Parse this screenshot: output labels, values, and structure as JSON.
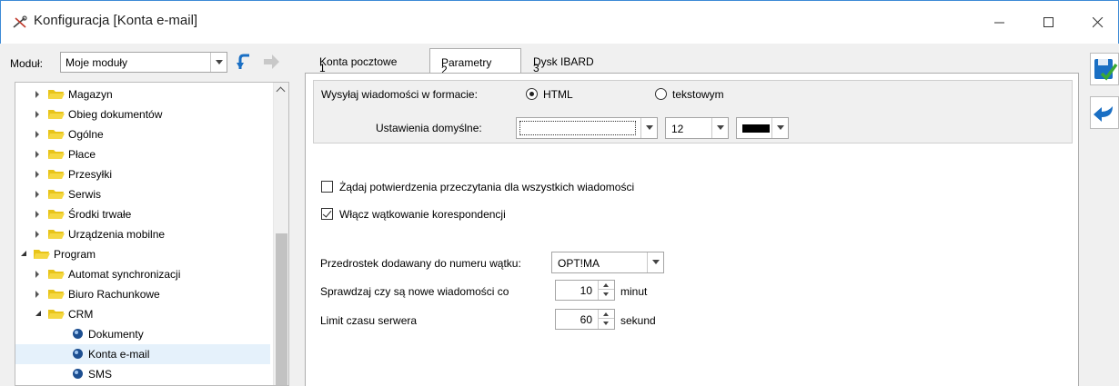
{
  "window": {
    "title": "Konfiguracja [Konta e-mail]"
  },
  "module": {
    "label": "Moduł:",
    "selected": "Moje moduły"
  },
  "tree": [
    {
      "label": "Magazyn",
      "level": 1,
      "expander": "closed",
      "icon": "folder-icon"
    },
    {
      "label": "Obieg dokumentów",
      "level": 1,
      "expander": "closed",
      "icon": "folder-icon"
    },
    {
      "label": "Ogólne",
      "level": 1,
      "expander": "closed",
      "icon": "folder-icon"
    },
    {
      "label": "Płace",
      "level": 1,
      "expander": "closed",
      "icon": "folder-icon"
    },
    {
      "label": "Przesyłki",
      "level": 1,
      "expander": "closed",
      "icon": "folder-icon"
    },
    {
      "label": "Serwis",
      "level": 1,
      "expander": "closed",
      "icon": "folder-icon"
    },
    {
      "label": "Środki trwałe",
      "level": 1,
      "expander": "closed",
      "icon": "folder-icon"
    },
    {
      "label": "Urządzenia mobilne",
      "level": 1,
      "expander": "closed",
      "icon": "folder-icon"
    },
    {
      "label": "Program",
      "level": 0,
      "expander": "open",
      "icon": "folder-icon"
    },
    {
      "label": "Automat synchronizacji",
      "level": 1,
      "expander": "closed",
      "icon": "folder-icon"
    },
    {
      "label": "Biuro Rachunkowe",
      "level": 1,
      "expander": "closed",
      "icon": "folder-icon"
    },
    {
      "label": "CRM",
      "level": 1,
      "expander": "open",
      "icon": "folder-icon"
    },
    {
      "label": "Dokumenty",
      "level": 2,
      "expander": "none",
      "icon": "settings-icon"
    },
    {
      "label": "Konta e-mail",
      "level": 2,
      "expander": "none",
      "icon": "settings-icon",
      "selected": true
    },
    {
      "label": "SMS",
      "level": 2,
      "expander": "none",
      "icon": "settings-icon"
    }
  ],
  "tabs": [
    {
      "key": "1",
      "label": "Konta pocztowe"
    },
    {
      "key": "2",
      "label": "Parametry",
      "active": true
    },
    {
      "key": "3",
      "label": "Dysk IBARD"
    }
  ],
  "params": {
    "format_label": "Wysyłaj wiadomości w formacie:",
    "format_html": "HTML",
    "format_text": "tekstowym",
    "format_selected": "HTML",
    "defaults_label": "Ustawienia domyślne:",
    "font_name": "",
    "font_size": "12",
    "font_color": "#000000",
    "read_receipt_label": "Żądaj potwierdzenia przeczytania dla wszystkich wiadomości",
    "read_receipt_checked": false,
    "threading_label": "Włącz wątkowanie korespondencji",
    "threading_checked": true,
    "prefix_label": "Przedrostek dodawany do numeru wątku:",
    "prefix_value": "OPT!MA",
    "check_label": "Sprawdzaj czy są nowe wiadomości co",
    "check_value": "10",
    "check_unit": "minut",
    "timeout_label": "Limit czasu serwera",
    "timeout_value": "60",
    "timeout_unit": "sekund"
  }
}
